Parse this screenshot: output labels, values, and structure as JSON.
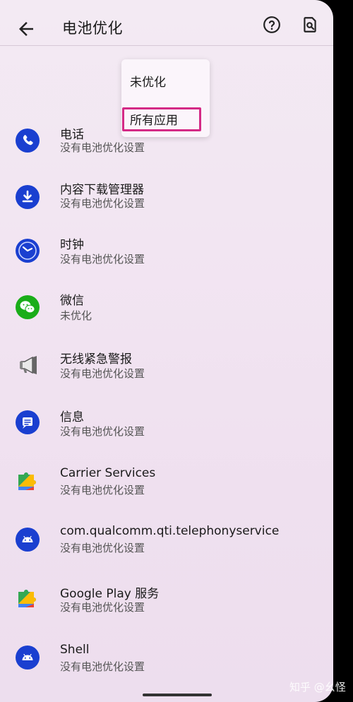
{
  "header": {
    "title": "电池优化",
    "back_icon": "arrow-back-icon",
    "help_icon": "help-circle-icon",
    "search_icon": "search-document-icon"
  },
  "dropdown": {
    "options": [
      "未优化",
      "所有应用"
    ],
    "highlighted": "所有应用",
    "highlight_color": "#d42a86"
  },
  "apps": [
    {
      "name": "电话",
      "status": "没有电池优化设置",
      "icon": "phone-icon"
    },
    {
      "name": "内容下载管理器",
      "status": "没有电池优化设置",
      "icon": "download-icon"
    },
    {
      "name": "时钟",
      "status": "没有电池优化设置",
      "icon": "clock-icon"
    },
    {
      "name": "微信",
      "status": "未优化",
      "icon": "wechat-icon"
    },
    {
      "name": "无线紧急警报",
      "status": "没有电池优化设置",
      "icon": "megaphone-icon"
    },
    {
      "name": "信息",
      "status": "没有电池优化设置",
      "icon": "messages-icon"
    },
    {
      "name": "Carrier Services",
      "status": "没有电池优化设置",
      "icon": "puzzle-icon"
    },
    {
      "name": "com.qualcomm.qti.telephonyservice",
      "status": "没有电池优化设置",
      "icon": "android-icon"
    },
    {
      "name": "Google Play 服务",
      "status": "没有电池优化设置",
      "icon": "puzzle-icon"
    },
    {
      "name": "Shell",
      "status": "没有电池优化设置",
      "icon": "android-icon"
    }
  ],
  "watermark": "知乎 @幺怪",
  "colors": {
    "accent_blue": "#1a3fd0",
    "wechat_green": "#1aad19"
  }
}
